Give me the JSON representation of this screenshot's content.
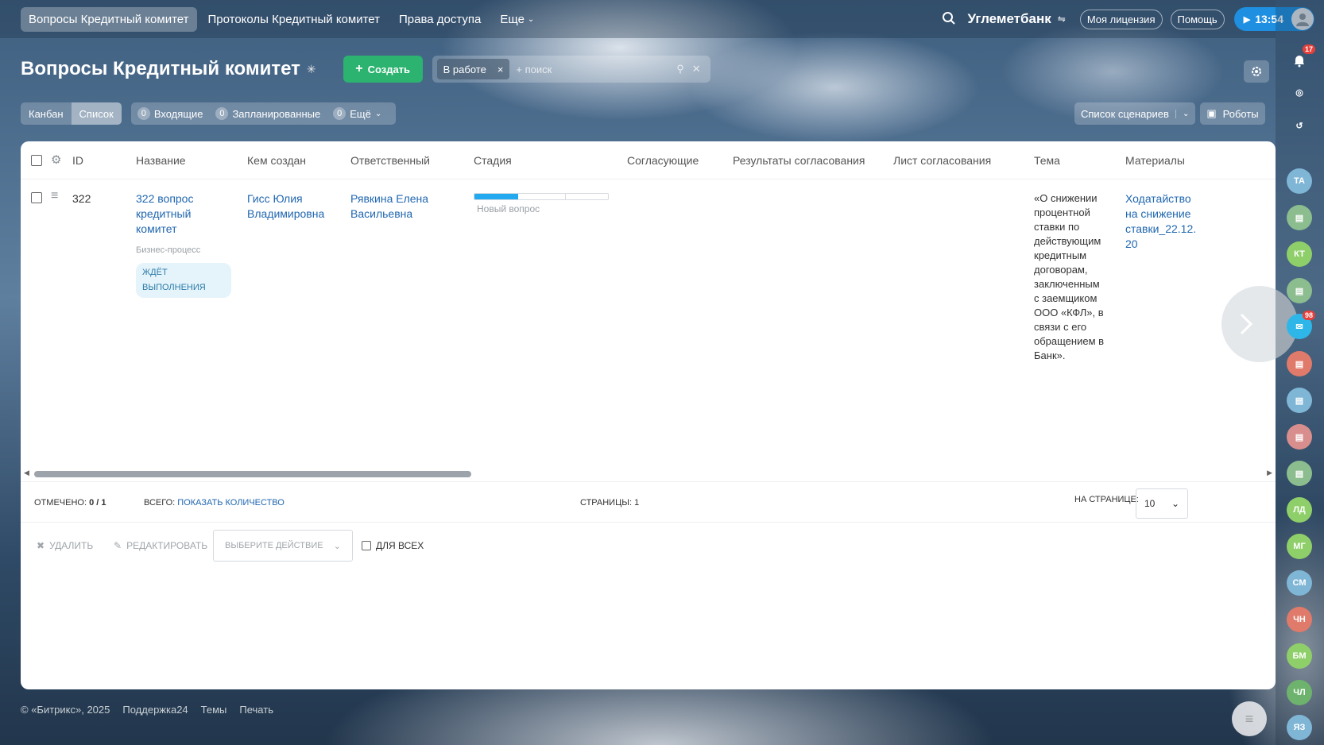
{
  "topbar": {
    "tabs": [
      {
        "label": "Вопросы Кредитный комитет"
      },
      {
        "label": "Протоколы Кредитный комитет"
      },
      {
        "label": "Права доступа"
      },
      {
        "label": "Еще"
      }
    ],
    "brand": "Углеметбанк",
    "license": "Моя лицензия",
    "help": "Помощь",
    "time": "13:54"
  },
  "page": {
    "title": "Вопросы Кредитный комитет",
    "create_label": "Создать",
    "filter_chip": "В работе",
    "search_placeholder": "+ поиск"
  },
  "toolbar": {
    "views": [
      {
        "label": "Канбан"
      },
      {
        "label": "Список"
      }
    ],
    "counters": [
      {
        "count": "0",
        "label": "Входящие"
      },
      {
        "count": "0",
        "label": "Запланированные"
      },
      {
        "count": "0",
        "label": "Ещё"
      }
    ],
    "scenarios": "Список сценариев",
    "robots": "Роботы"
  },
  "table": {
    "columns": [
      "ID",
      "Название",
      "Кем создан",
      "Ответственный",
      "Стадия",
      "Согласующие",
      "Результаты согласования",
      "Лист согласования",
      "Тема",
      "Материалы"
    ],
    "row": {
      "id": "322",
      "name": "322 вопрос кредитный комитет",
      "bp_label": "Бизнес-процесс",
      "bp_status": "ЖДЁТ ВЫПОЛНЕНИЯ",
      "created_by": "Гисс Юлия Владимировна",
      "responsible": "Рявкина Елена Васильевна",
      "stage": "Новый вопрос",
      "topic": "«О снижении процентной ставки по действующим кредитным договорам, заключенным с заемщиком ООО «КФЛ», в связи с его обращением в Банк».",
      "materials": "Ходатайство на снижение ставки_22.12.20"
    }
  },
  "footer_bar": {
    "checked_label": "ОТМЕЧЕНО:",
    "checked_value": "0 / 1",
    "total_label": "ВСЕГО:",
    "total_link": "ПОКАЗАТЬ КОЛИЧЕСТВО",
    "pages_label": "СТРАНИЦЫ:",
    "pages_value": "1",
    "per_page_label": "НА СТРАНИЦЕ:",
    "per_page_value": "10"
  },
  "actions": {
    "delete": "УДАЛИТЬ",
    "edit": "РЕДАКТИРОВАТЬ",
    "choose": "ВЫБЕРИТЕ ДЕЙСТВИЕ",
    "for_all": "ДЛЯ ВСЕХ"
  },
  "page_footer": {
    "copyright": "© «Битрикс», 2025",
    "support": "Поддержка24",
    "themes": "Темы",
    "print": "Печать"
  },
  "right_panel": {
    "notifications": "17",
    "chat_count": "98",
    "avatars": [
      {
        "initials": "ТА",
        "color": "#7fb6d6"
      },
      {
        "initials": "",
        "color": "#8bbd8f"
      },
      {
        "initials": "КТ",
        "color": "#8fcf6a"
      },
      {
        "initials": "",
        "color": "#8bbd8f"
      },
      {
        "initials": "",
        "color": "#e07a6a"
      },
      {
        "initials": "",
        "color": "#7fb6d6"
      },
      {
        "initials": "",
        "color": "#d98e8e"
      },
      {
        "initials": "",
        "color": "#8bbd8f"
      },
      {
        "initials": "ЛД",
        "color": "#8fcf6a"
      },
      {
        "initials": "МГ",
        "color": "#8fcf6a"
      },
      {
        "initials": "СМ",
        "color": "#7fb6d6"
      },
      {
        "initials": "ЧН",
        "color": "#e07a6a"
      },
      {
        "initials": "БМ",
        "color": "#8fcf6a"
      },
      {
        "initials": "ЧЛ",
        "color": "#6db36d"
      },
      {
        "initials": "ЯЗ",
        "color": "#7fb6d6"
      }
    ]
  },
  "colors": {
    "accent": "#2bb36f",
    "link": "#2067b0",
    "stage": "#22a9ef",
    "time_button": "#1e8fe1"
  }
}
